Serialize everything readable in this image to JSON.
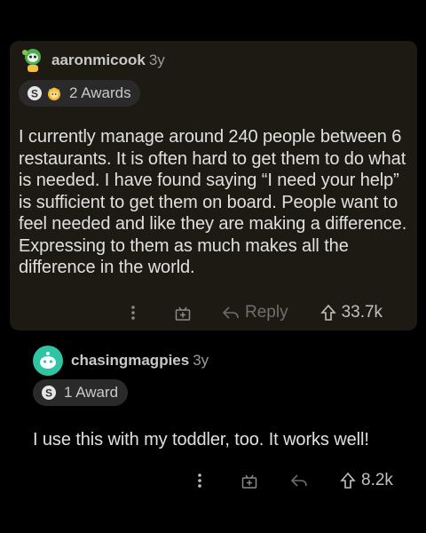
{
  "comments": [
    {
      "author": "aaronmicook",
      "age": "3y",
      "awards_label": "2 Awards",
      "body": "I currently manage around 240 people between 6 restaurants. It is often hard to get them to do what is needed. I have found saying  “I need your help” is sufficient to get them on board. People want to feel needed and like they are making a difference. Expressing to them as much makes all the difference in the world.",
      "reply_label": "Reply",
      "votes": "33.7k",
      "highlight_color": "#1c1a12"
    },
    {
      "author": "chasingmagpies",
      "age": "3y",
      "awards_label": "1 Award",
      "body": "I use this with my toddler, too. It works well!",
      "reply_label": "",
      "votes": "8.2k"
    }
  ],
  "icons": {
    "avatar_1": "snoo-avatar-green-icon",
    "avatar_2": "snoo-avatar-teal-icon",
    "silver_award": "silver-award-icon",
    "wholesome_award": "wholesome-award-icon",
    "more": "more-options-icon",
    "give_award": "gift-icon",
    "reply": "reply-arrow-icon",
    "upvote": "upvote-arrow-icon"
  }
}
